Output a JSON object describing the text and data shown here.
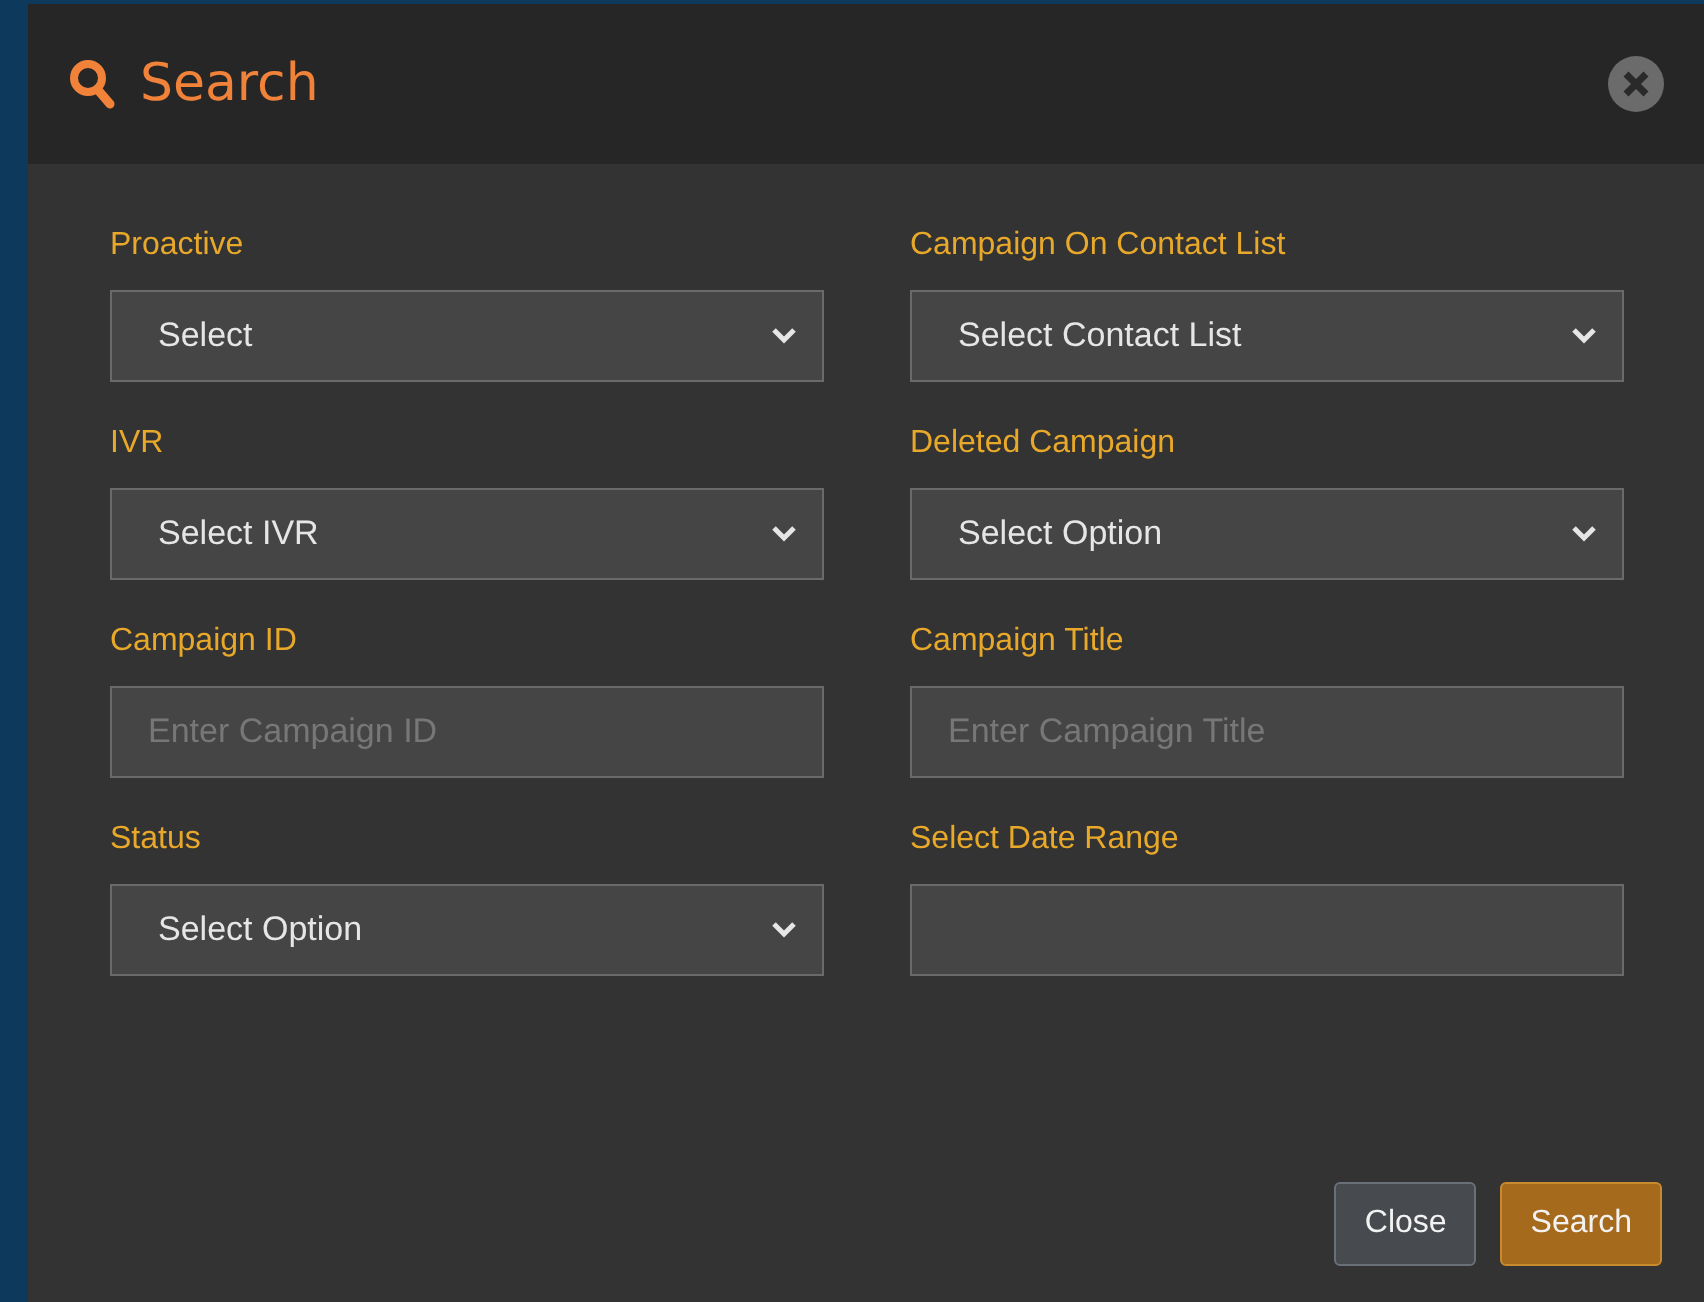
{
  "dialog": {
    "title": "Search"
  },
  "fields": [
    {
      "label": "Proactive",
      "kind": "select",
      "value": "Select"
    },
    {
      "label": "Campaign On Contact List",
      "kind": "select",
      "value": "Select Contact List"
    },
    {
      "label": "IVR",
      "kind": "select",
      "value": "Select IVR"
    },
    {
      "label": "Deleted Campaign",
      "kind": "select",
      "value": "Select Option"
    },
    {
      "label": "Campaign ID",
      "kind": "input",
      "placeholder": "Enter Campaign ID"
    },
    {
      "label": "Campaign Title",
      "kind": "input",
      "placeholder": "Enter Campaign Title"
    },
    {
      "label": "Status",
      "kind": "select",
      "value": "Select Option"
    },
    {
      "label": "Select Date Range",
      "kind": "input"
    }
  ],
  "buttons": [
    {
      "label": "Close",
      "kind": "secondary"
    },
    {
      "label": "Search",
      "kind": "primary"
    }
  ]
}
